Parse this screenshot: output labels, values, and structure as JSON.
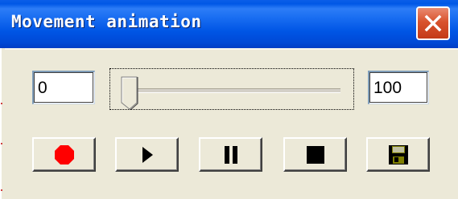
{
  "window": {
    "title": "Movement animation"
  },
  "controls": {
    "min_value": "0",
    "max_value": "100",
    "slider_value": 0
  },
  "buttons": [
    {
      "name": "record",
      "icon": "record-icon"
    },
    {
      "name": "play",
      "icon": "play-icon"
    },
    {
      "name": "pause",
      "icon": "pause-icon"
    },
    {
      "name": "stop",
      "icon": "stop-icon"
    },
    {
      "name": "save",
      "icon": "floppy-disk-icon"
    }
  ],
  "colors": {
    "titlebar": "#0055e5",
    "close": "#d9532d",
    "record": "#ff0000",
    "panel": "#ece9d8"
  }
}
